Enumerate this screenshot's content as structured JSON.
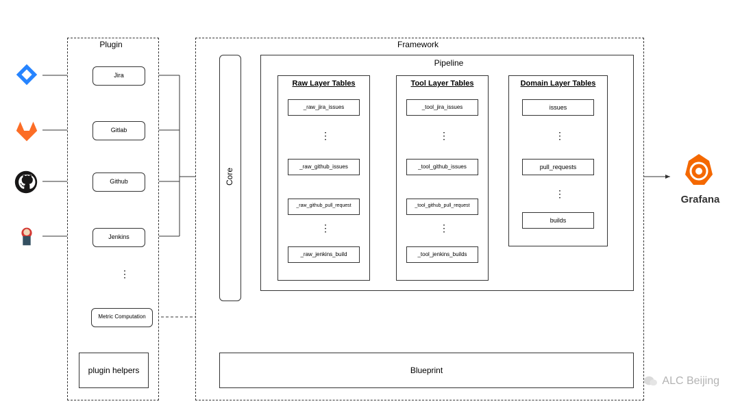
{
  "containers": {
    "plugin": "Plugin",
    "framework": "Framework",
    "pipeline": "Pipeline",
    "blueprint": "Blueprint",
    "plugin_helpers": "plugin helpers",
    "core": "Core"
  },
  "plugins": [
    {
      "name": "Jira",
      "icon": "jira"
    },
    {
      "name": "Gitlab",
      "icon": "gitlab"
    },
    {
      "name": "Github",
      "icon": "github"
    },
    {
      "name": "Jenkins",
      "icon": "jenkins"
    }
  ],
  "metric_computation": "Metric Computation",
  "columns": {
    "raw": {
      "title": "Raw Layer Tables",
      "items": [
        "_raw_jira_issues",
        "_raw_github_issues",
        "_raw_github_pull_request",
        "_raw_jenkins_build"
      ]
    },
    "tool": {
      "title": "Tool Layer  Tables",
      "items": [
        "_tool_jira_issues",
        "_tool_github_issues",
        "_tool_github_pull_request",
        "_tool_jenkins_builds"
      ]
    },
    "domain": {
      "title": "Domain  Layer Tables",
      "items": [
        "issues",
        "pull_requests",
        "builds"
      ]
    }
  },
  "output": "Grafana",
  "watermark": "ALC Beijing"
}
